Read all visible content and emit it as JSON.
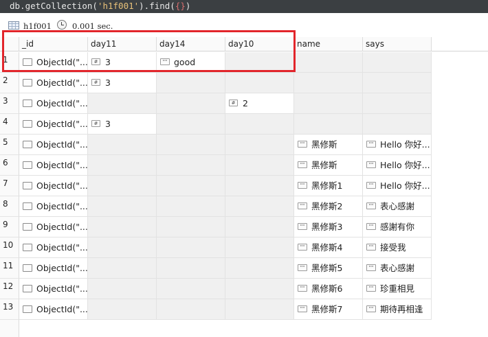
{
  "query": {
    "prefix": "db.getCollection(",
    "collection_literal": "'h1f001'",
    "middle": ").find(",
    "filter_literal": "{}",
    "suffix": ")"
  },
  "status": {
    "collection": "h1f001",
    "time": "0.001 sec."
  },
  "icons": {
    "object": "object-type-icon",
    "number": "number-type-icon",
    "string": "string-type-icon"
  },
  "colors": {
    "highlight": "#e2252b",
    "query_bg": "#3b3f42"
  },
  "columns": [
    "_id",
    "day11",
    "day14",
    "day10",
    "name",
    "says"
  ],
  "rows": [
    {
      "n": "1",
      "_id": "ObjectId(\"...",
      "day11": "3",
      "day14": "good",
      "day10": "",
      "name": "",
      "says": ""
    },
    {
      "n": "2",
      "_id": "ObjectId(\"...",
      "day11": "3",
      "day14": "",
      "day10": "",
      "name": "",
      "says": ""
    },
    {
      "n": "3",
      "_id": "ObjectId(\"...",
      "day11": "",
      "day14": "",
      "day10": "2",
      "name": "",
      "says": ""
    },
    {
      "n": "4",
      "_id": "ObjectId(\"...",
      "day11": "3",
      "day14": "",
      "day10": "",
      "name": "",
      "says": ""
    },
    {
      "n": "5",
      "_id": "ObjectId(\"...",
      "day11": "",
      "day14": "",
      "day10": "",
      "name": "黑修斯",
      "says": "Hello 你好..."
    },
    {
      "n": "6",
      "_id": "ObjectId(\"...",
      "day11": "",
      "day14": "",
      "day10": "",
      "name": "黑修斯",
      "says": "Hello 你好..."
    },
    {
      "n": "7",
      "_id": "ObjectId(\"...",
      "day11": "",
      "day14": "",
      "day10": "",
      "name": "黑修斯1",
      "says": "Hello 你好..."
    },
    {
      "n": "8",
      "_id": "ObjectId(\"...",
      "day11": "",
      "day14": "",
      "day10": "",
      "name": "黑修斯2",
      "says": "表心感謝"
    },
    {
      "n": "9",
      "_id": "ObjectId(\"...",
      "day11": "",
      "day14": "",
      "day10": "",
      "name": "黑修斯3",
      "says": "感謝有你"
    },
    {
      "n": "10",
      "_id": "ObjectId(\"...",
      "day11": "",
      "day14": "",
      "day10": "",
      "name": "黑修斯4",
      "says": "接受我"
    },
    {
      "n": "11",
      "_id": "ObjectId(\"...",
      "day11": "",
      "day14": "",
      "day10": "",
      "name": "黑修斯5",
      "says": "表心感謝"
    },
    {
      "n": "12",
      "_id": "ObjectId(\"...",
      "day11": "",
      "day14": "",
      "day10": "",
      "name": "黑修斯6",
      "says": "珍重相見"
    },
    {
      "n": "13",
      "_id": "ObjectId(\"...",
      "day11": "",
      "day14": "",
      "day10": "",
      "name": "黑修斯7",
      "says": "期待再相逢"
    }
  ]
}
